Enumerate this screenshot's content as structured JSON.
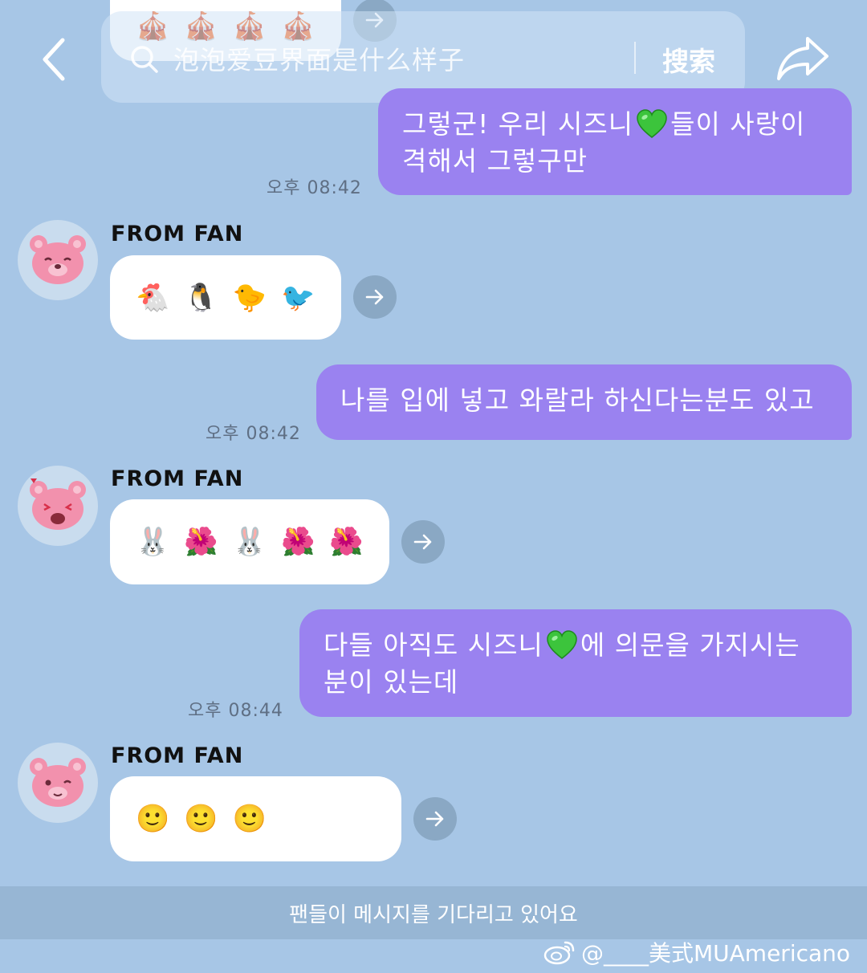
{
  "search": {
    "placeholder": "泡泡爱豆界面是什么样子",
    "button_label": "搜索"
  },
  "top_card": {
    "emojis": [
      "🎪",
      "🎪",
      "🎪",
      "🎪"
    ]
  },
  "messages": [
    {
      "line1": "그렇군! 우리 시즈니",
      "line1b": "들이 사랑이",
      "line2": "격해서 그렇구만",
      "time": "오후 08:42"
    },
    {
      "fan_label": "FROM FAN",
      "emojis": [
        "🐔",
        "🐧",
        "🐤",
        "🐦"
      ]
    },
    {
      "line1": "나를 입에 넣고 와랄라 하신다는분도 있고",
      "time": "오후 08:42"
    },
    {
      "fan_label": "FROM FAN",
      "emojis": [
        "🐰",
        "🌺",
        "🐰",
        "🌺",
        "🌺"
      ]
    },
    {
      "line1": "다들 아직도 시즈니",
      "line1b": "에 의문을 가지시는",
      "line2": "분이 있는데",
      "time": "오후 08:44"
    },
    {
      "fan_label": "FROM FAN",
      "emojis": [
        "🙂",
        "🙂",
        "🙂"
      ]
    }
  ],
  "status": {
    "text": "팬들이 메시지를 기다리고 있어요"
  },
  "watermark": {
    "text": "@____美式MUAmericano"
  },
  "colors": {
    "background": "#a7c6e6",
    "bubble_purple": "#9a82f0",
    "heart_green": "#3cc43c"
  }
}
